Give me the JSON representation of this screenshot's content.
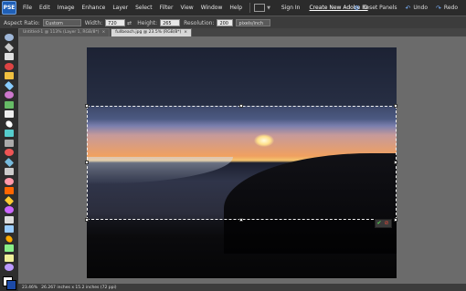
{
  "app": {
    "logo_text": "PSE"
  },
  "menubar": {
    "items": [
      "File",
      "Edit",
      "Image",
      "Enhance",
      "Layer",
      "Select",
      "Filter",
      "View",
      "Window",
      "Help"
    ],
    "sign_in": "Sign In",
    "create_id": "Create New Adobe ID",
    "reset_panels": "Reset Panels",
    "undo": "Undo",
    "redo": "Redo"
  },
  "options": {
    "aspect_label": "Aspect Ratio:",
    "aspect_value": "Custom",
    "width_label": "Width:",
    "width_value": "720 px",
    "height_label": "Height:",
    "height_value": "265 px",
    "resolution_label": "Resolution:",
    "resolution_value": "200",
    "resolution_unit": "pixels/inch"
  },
  "tabs": [
    {
      "label": "Untitled-1 @ 113% (Layer 1, RGB/8*)",
      "active": false
    },
    {
      "label": "fullbeach.jpg @ 23.5% (RGB/8*)",
      "active": true
    }
  ],
  "status": {
    "zoom": "23.46%",
    "doc_info": "26.267 inches x 15.2 inches (72 ppi)"
  },
  "colors": {
    "accent": "#1f5fb6",
    "menubar": "#2b2b2b",
    "canvas": "#6b6b6b"
  },
  "icons": [
    "move-icon",
    "zoom-icon",
    "hand-icon",
    "eyedropper-icon",
    "marquee-icon",
    "lasso-icon",
    "magic-wand-icon",
    "selection-brush-icon",
    "type-icon",
    "crop-icon",
    "cookie-cutter-icon",
    "straighten-icon",
    "red-eye-icon",
    "spot-healing-icon",
    "clone-stamp-icon",
    "eraser-icon",
    "brush-icon",
    "paint-bucket-icon",
    "gradient-icon",
    "shape-icon",
    "blur-icon",
    "sponge-icon",
    "smudge-icon",
    "dodge-icon",
    "color-replace-icon"
  ]
}
